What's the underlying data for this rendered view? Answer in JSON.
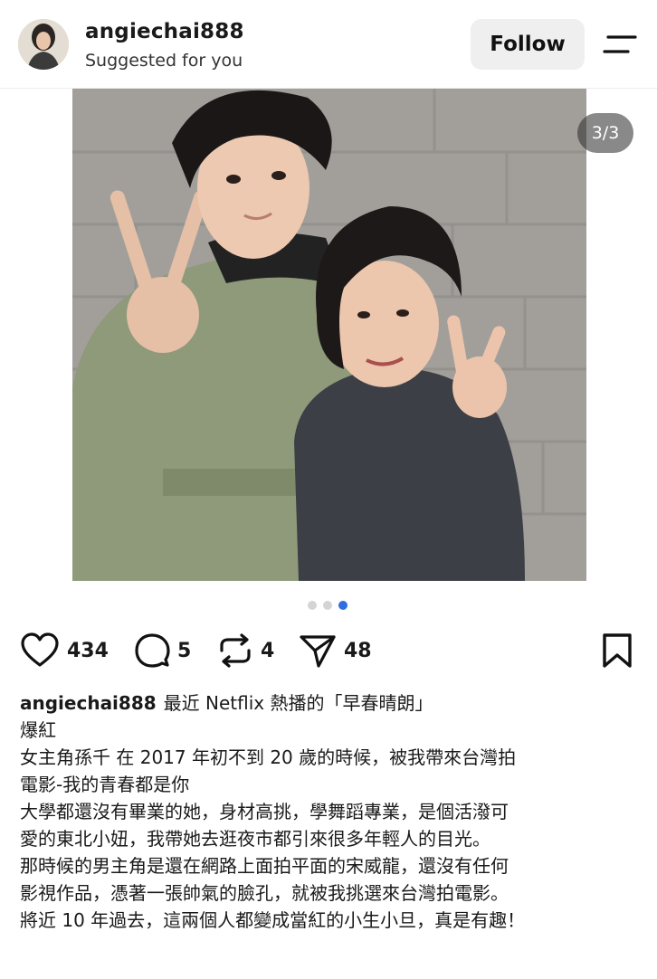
{
  "header": {
    "username": "angiechai888",
    "subtitle": "Suggested for you",
    "follow_label": "Follow"
  },
  "media": {
    "counter": "3/3",
    "slide_count": 3,
    "active_slide": 3
  },
  "actions": {
    "likes": "434",
    "comments": "5",
    "reposts": "4",
    "shares": "48"
  },
  "caption": {
    "username": "angiechai888",
    "lines": [
      "最近 Netflix 熱播的「早春晴朗」",
      "爆紅",
      "女主角孫千 在 2017 年初不到 20 歲的時候，被我帶來台灣拍",
      "電影-我的青春都是你",
      "大學都還沒有畢業的她，身材高挑，學舞蹈專業，是個活潑可",
      "愛的東北小妞，我帶她去逛夜市都引來很多年輕人的目光。",
      "那時候的男主角是還在網路上面拍平面的宋威龍，還沒有任何",
      "影視作品，憑著一張帥氣的臉孔，就被我挑選來台灣拍電影。",
      "將近 10 年過去，這兩個人都變成當紅的小生小旦，真是有趣！"
    ]
  },
  "colors": {
    "accent_dot": "#2f6de1",
    "follow_bg": "#efefef"
  }
}
